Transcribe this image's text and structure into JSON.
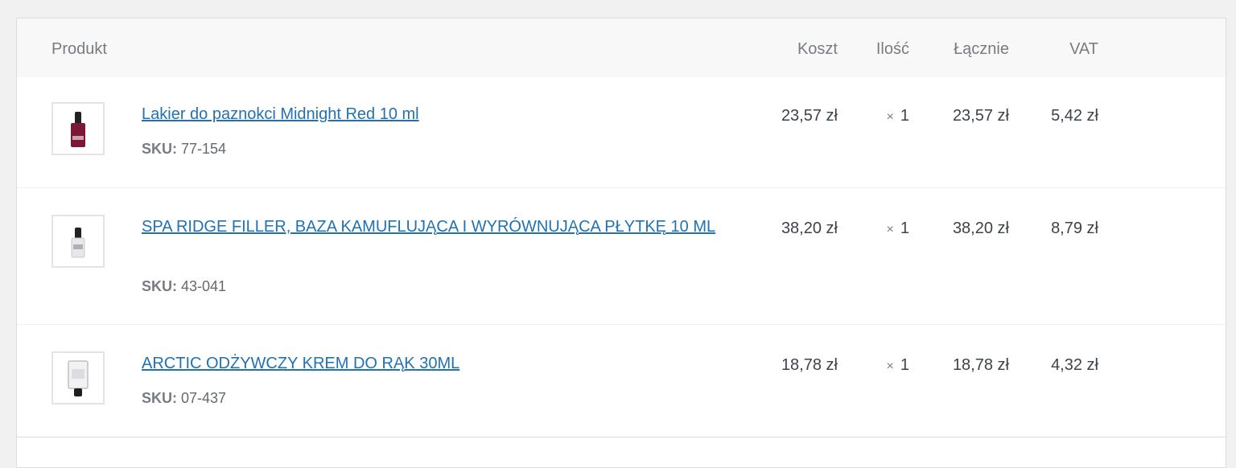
{
  "header": {
    "product": "Produkt",
    "cost": "Koszt",
    "qty": "Ilość",
    "total": "Łącznie",
    "vat": "VAT"
  },
  "sku_label": "SKU:",
  "qty_sign": "×",
  "colors": {
    "link": "#2271b1",
    "header_bg": "#f8f8f8",
    "page_bg": "#f1f1f1"
  },
  "items": [
    {
      "name": "Lakier do paznokci Midnight Red 10 ml",
      "sku": "77-154",
      "cost": "23,57 zł",
      "qty": "1",
      "total": "23,57 zł",
      "vat": "5,42 zł",
      "thumbnail_icon": "nail-polish-bottle-red-icon"
    },
    {
      "name": "SPA RIDGE FILLER, BAZA KAMUFLUJĄCA I WYRÓWNUJĄCA PŁYTKĘ 10 ML",
      "sku": "43-041",
      "cost": "38,20 zł",
      "qty": "1",
      "total": "38,20 zł",
      "vat": "8,79 zł",
      "thumbnail_icon": "nail-base-bottle-icon"
    },
    {
      "name": "ARCTIC ODŻYWCZY KREM DO RĄK 30ML",
      "sku": "07-437",
      "cost": "18,78 zł",
      "qty": "1",
      "total": "18,78 zł",
      "vat": "4,32 zł",
      "thumbnail_icon": "hand-cream-tube-icon"
    }
  ]
}
